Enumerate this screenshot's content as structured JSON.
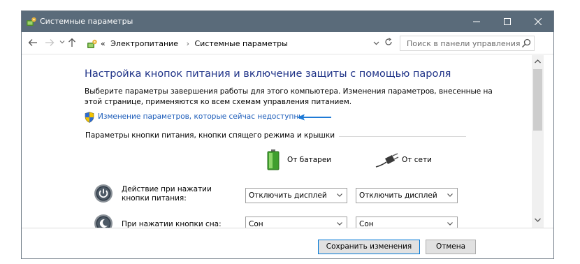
{
  "window": {
    "title": "Системные параметры"
  },
  "address": {
    "prefix": "«",
    "crumbs": [
      "Электропитание",
      "Системные параметры"
    ],
    "separator": "›"
  },
  "search": {
    "placeholder": "Поиск в панели управления"
  },
  "content": {
    "heading": "Настройка кнопок питания и включение защиты с помощью пароля",
    "description": "Выберите параметры завершения работы для этого компьютера. Изменения параметров, внесенные на этой странице, применяются ко всем схемам управления питанием.",
    "change_link": "Изменение параметров, которые сейчас недоступны",
    "group_label": "Параметры кнопки питания, кнопки спящего режима и крышки",
    "columns": {
      "battery": "От батареи",
      "power": "От сети"
    },
    "rows": [
      {
        "label": "Действие при нажатии кнопки питания:",
        "battery": "Отключить дисплей",
        "power": "Отключить дисплей"
      },
      {
        "label": "При нажатии кнопки сна:",
        "battery": "Сон",
        "power": "Сон"
      }
    ]
  },
  "footer": {
    "save": "Сохранить изменения",
    "cancel": "Отмена"
  },
  "colors": {
    "titlebar": "#5a6b7a",
    "heading": "#1e3287",
    "link": "#1a5bb9",
    "accent_border": "#0078d7",
    "arrow": "#1e7ad6"
  },
  "icons": {
    "window": "control-panel-icon",
    "link": "uac-shield-icon",
    "battery": "battery-icon",
    "power": "power-plug-icon",
    "row1": "power-button-icon",
    "row2": "sleep-button-icon"
  }
}
